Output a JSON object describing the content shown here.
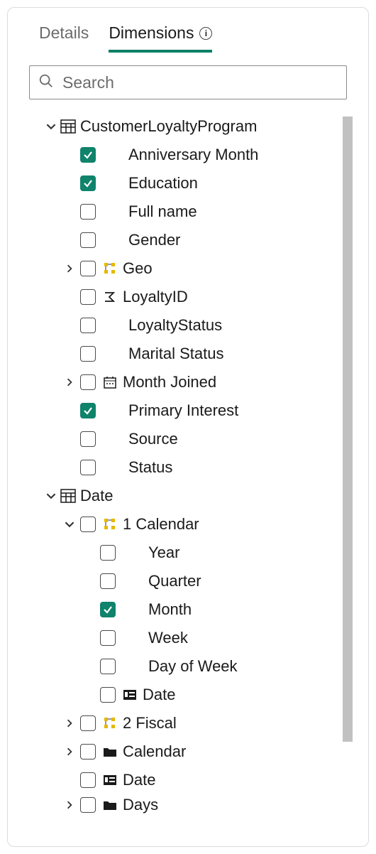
{
  "tabs": {
    "details": "Details",
    "dimensions": "Dimensions"
  },
  "search": {
    "placeholder": "Search"
  },
  "tree": {
    "customerLoyalty": {
      "label": "CustomerLoyaltyProgram",
      "anniversary": "Anniversary Month",
      "education": "Education",
      "fullname": "Full name",
      "gender": "Gender",
      "geo": "Geo",
      "loyaltyId": "LoyaltyID",
      "loyaltyStatus": "LoyaltyStatus",
      "marital": "Marital Status",
      "monthJoined": "Month Joined",
      "primaryInterest": "Primary Interest",
      "source": "Source",
      "status": "Status"
    },
    "date": {
      "label": "Date",
      "calendar1": "1 Calendar",
      "year": "Year",
      "quarter": "Quarter",
      "month": "Month",
      "week": "Week",
      "dow": "Day of Week",
      "dateLeaf": "Date",
      "fiscal2": "2 Fiscal",
      "calendar": "Calendar",
      "date2": "Date",
      "days": "Days"
    }
  }
}
